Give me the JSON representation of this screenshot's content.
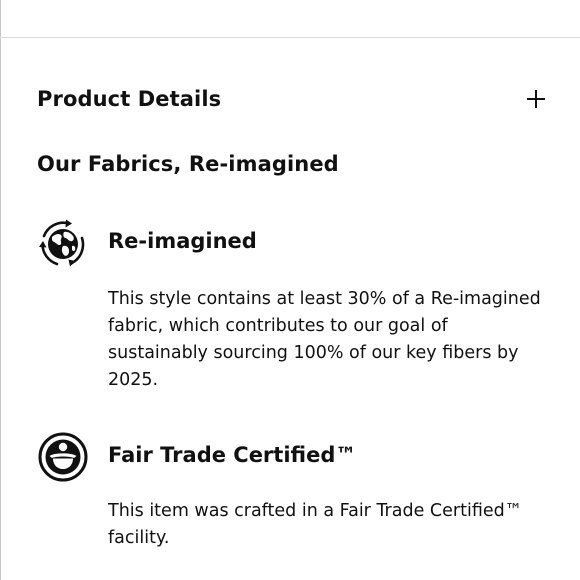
{
  "accordion": {
    "title": "Product Details"
  },
  "fabrics": {
    "heading": "Our Fabrics, Re-imagined",
    "items": [
      {
        "icon": "globe-recycle-icon",
        "title": "Re-imagined",
        "description": "This style contains at least 30% of a Re-imagined fabric, which contributes to our goal of sustainably sourcing 100% of our key fibers by 2025."
      },
      {
        "icon": "fair-trade-icon",
        "title": "Fair Trade Certified™",
        "description": "This item was crafted in a Fair Trade Certified™ facility."
      }
    ]
  }
}
